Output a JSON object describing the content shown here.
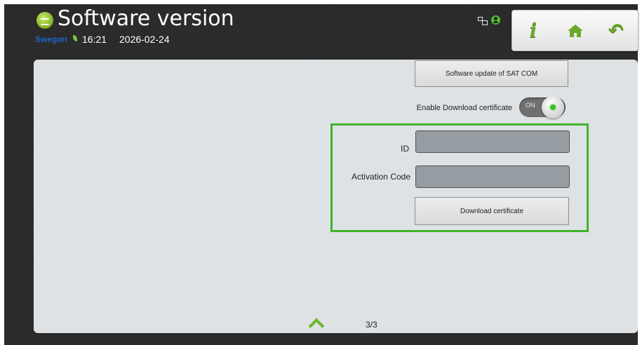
{
  "header": {
    "title": "Software version",
    "brand": "Swegon",
    "time": "16:21",
    "date": "2026-02-24"
  },
  "status_icons": [
    "network-icon",
    "user-icon"
  ],
  "nav": {
    "info_glyph": "i",
    "home_icon": "home-icon",
    "back_glyph": "↶"
  },
  "main": {
    "sat_com_button": "Software update of SAT COM",
    "enable_download_label": "Enable Download certificate",
    "toggle": {
      "state_text": "ON",
      "on": true
    },
    "certificate_form": {
      "id_label": "ID",
      "id_value": "",
      "activation_code_label": "Activation Code",
      "activation_code_value": "",
      "download_button": "Download certificate"
    },
    "pager": {
      "page": "3/3"
    }
  },
  "colors": {
    "accent_green": "#3db52a",
    "background": "#2a2a2a",
    "panel": "#dfe2e4",
    "input_fill": "#959ca2"
  }
}
